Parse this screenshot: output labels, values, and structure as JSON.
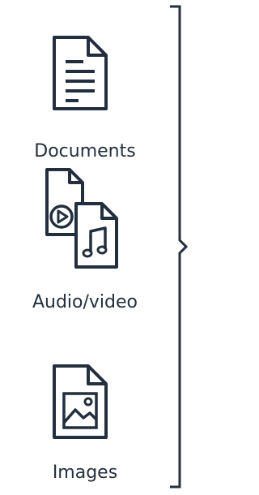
{
  "items": [
    {
      "label": "Documents",
      "icon": "document-icon"
    },
    {
      "label": "Audio/video",
      "icon": "audio-video-files-icon"
    },
    {
      "label": "Images",
      "icon": "image-file-icon"
    }
  ],
  "colors": {
    "stroke": "#232f3e",
    "background": "#ffffff"
  }
}
